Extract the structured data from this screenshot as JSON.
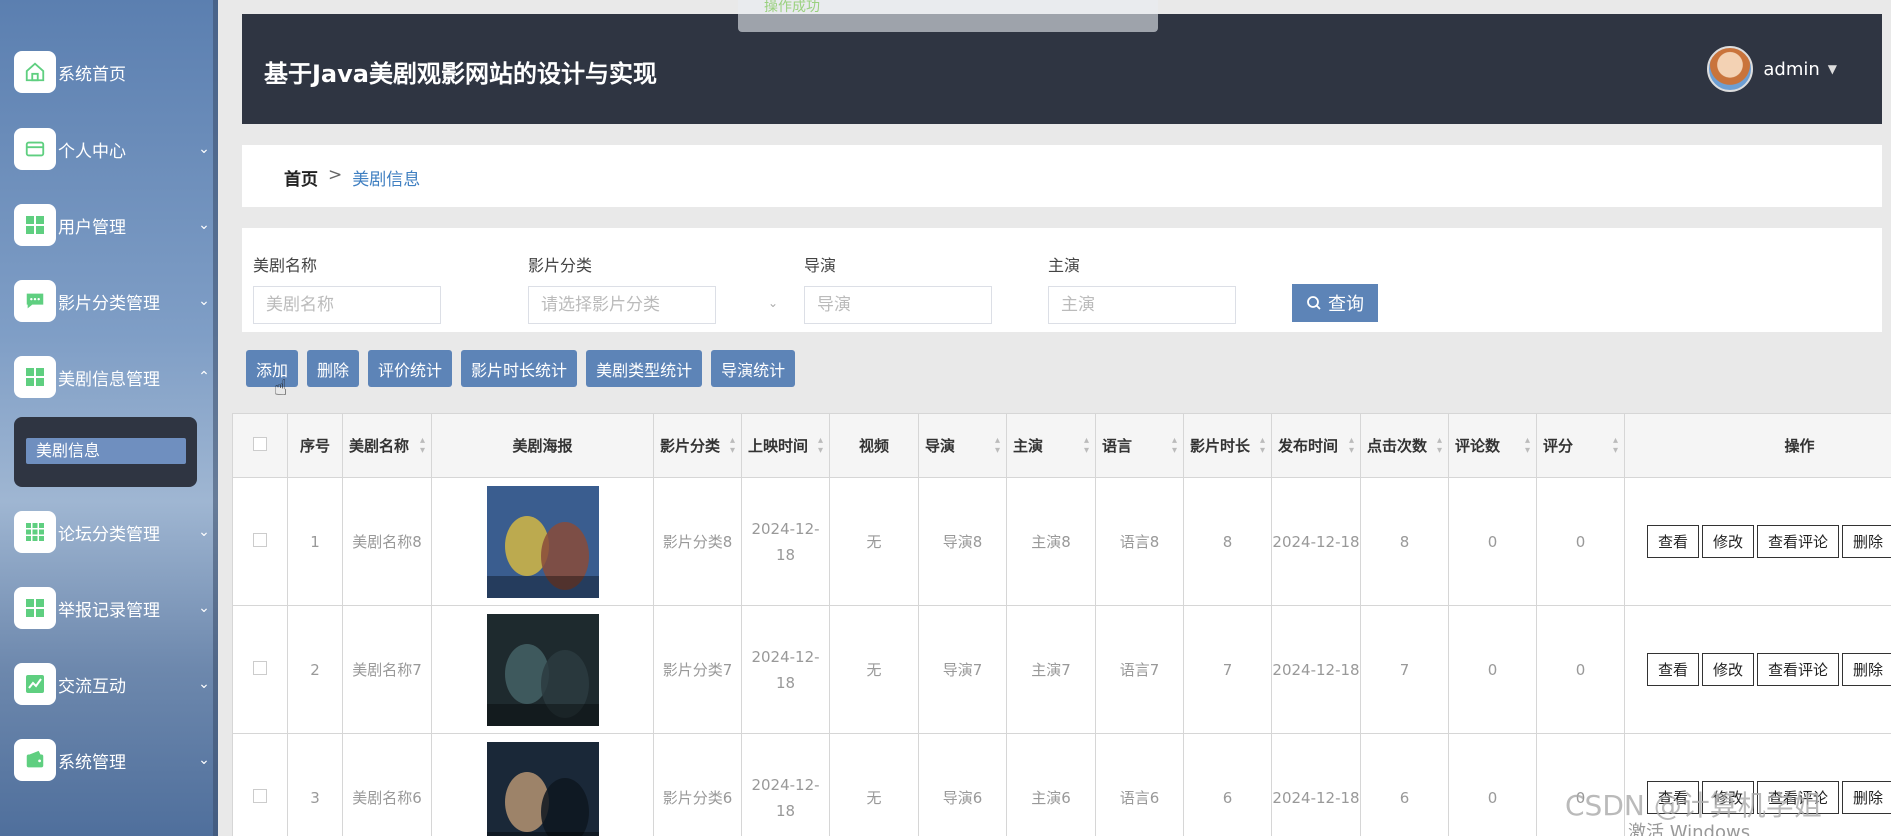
{
  "sidebar": {
    "items": [
      {
        "label": "系统首页",
        "icon": "home-icon",
        "expandable": false
      },
      {
        "label": "个人中心",
        "icon": "card-icon",
        "expandable": true
      },
      {
        "label": "用户管理",
        "icon": "grid-icon",
        "expandable": true
      },
      {
        "label": "影片分类管理",
        "icon": "chat-icon",
        "expandable": true
      },
      {
        "label": "美剧信息管理",
        "icon": "grid-icon",
        "expandable": true,
        "expanded": true
      },
      {
        "label": "论坛分类管理",
        "icon": "apps-icon",
        "expandable": true
      },
      {
        "label": "举报记录管理",
        "icon": "grid-icon",
        "expandable": true
      },
      {
        "label": "交流互动",
        "icon": "chart-icon",
        "expandable": true
      },
      {
        "label": "系统管理",
        "icon": "wallet-icon",
        "expandable": true
      }
    ],
    "submenu": {
      "label": "美剧信息"
    },
    "icon_color": "#5fcf80"
  },
  "header": {
    "title": "基于Java美剧观影网站的设计与实现",
    "username": "admin",
    "bg": "#2f3542",
    "toast": "操作成功"
  },
  "breadcrumb": {
    "home": "首页",
    "separator": ">",
    "current": "美剧信息"
  },
  "search": {
    "fields": [
      {
        "label": "美剧名称",
        "placeholder": "美剧名称"
      },
      {
        "label": "影片分类",
        "placeholder": "请选择影片分类"
      },
      {
        "label": "导演",
        "placeholder": "导演"
      },
      {
        "label": "主演",
        "placeholder": "主演"
      }
    ],
    "query_button": "查询"
  },
  "actions": [
    "添加",
    "删除",
    "评价统计",
    "影片时长统计",
    "美剧类型统计",
    "导演统计"
  ],
  "table": {
    "headers": [
      "序号",
      "美剧名称",
      "美剧海报",
      "影片分类",
      "上映时间",
      "视频",
      "导演",
      "主演",
      "语言",
      "影片时长",
      "发布时间",
      "点击次数",
      "评论数",
      "评分",
      "操作"
    ],
    "rows": [
      {
        "no": "1",
        "name": "美剧名称8",
        "category": "影片分类8",
        "release": "2024-12-18",
        "video": "无",
        "director": "导演8",
        "actor": "主演8",
        "language": "语言8",
        "duration": "8",
        "publish": "2024-12-18",
        "clicks": "8",
        "comments": "0",
        "rating": "0",
        "poster_colors": [
          "#3a5d8f",
          "#e8c43a",
          "#8a4b3a"
        ]
      },
      {
        "no": "2",
        "name": "美剧名称7",
        "category": "影片分类7",
        "release": "2024-12-18",
        "video": "无",
        "director": "导演7",
        "actor": "主演7",
        "language": "语言7",
        "duration": "7",
        "publish": "2024-12-18",
        "clicks": "7",
        "comments": "0",
        "rating": "0",
        "poster_colors": [
          "#1e2a2e",
          "#4a6a6e",
          "#2c3b3f"
        ]
      },
      {
        "no": "3",
        "name": "美剧名称6",
        "category": "影片分类6",
        "release": "2024-12-18",
        "video": "无",
        "director": "导演6",
        "actor": "主演6",
        "language": "语言6",
        "duration": "6",
        "publish": "2024-12-18",
        "clicks": "6",
        "comments": "0",
        "rating": "0",
        "poster_colors": [
          "#1a2838",
          "#c9a27a",
          "#0e1620"
        ]
      }
    ],
    "row_actions": [
      "查看",
      "修改",
      "查看评论",
      "删除"
    ]
  },
  "watermark": "CSDN @计算机学姐",
  "activate_windows": "激活 Windows"
}
